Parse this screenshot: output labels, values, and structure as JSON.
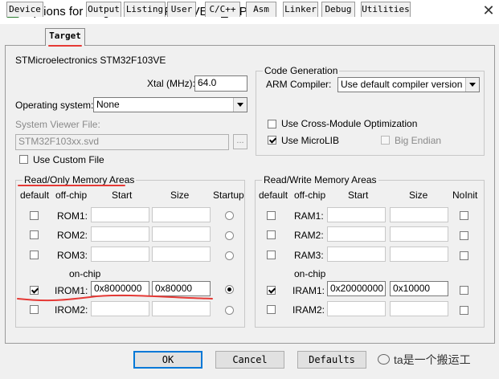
{
  "window": {
    "title": "Options for Target 'STM32F103VETx_IAP'"
  },
  "tabs": [
    {
      "label": "Device"
    },
    {
      "label": "Target"
    },
    {
      "label": "Output"
    },
    {
      "label": "Listing"
    },
    {
      "label": "User"
    },
    {
      "label": "C/C++"
    },
    {
      "label": "Asm"
    },
    {
      "label": "Linker"
    },
    {
      "label": "Debug"
    },
    {
      "label": "Utilities"
    }
  ],
  "active_tab": "Target",
  "device": {
    "name": "STMicroelectronics STM32F103VE"
  },
  "xtal": {
    "label": "Xtal (MHz):",
    "value": "64.0"
  },
  "os": {
    "label": "Operating system:",
    "value": "None"
  },
  "svf": {
    "label": "System Viewer File:",
    "value": "STM32F103xx.svd",
    "browse": "..."
  },
  "custom_file": {
    "label": "Use Custom File",
    "checked": false
  },
  "codegen": {
    "title": "Code Generation",
    "compiler_label": "ARM Compiler:",
    "compiler_value": "Use default compiler version",
    "cross_module": {
      "label": "Use Cross-Module Optimization",
      "checked": false
    },
    "microlib": {
      "label": "Use MicroLIB",
      "checked": true
    },
    "big_endian": {
      "label": "Big Endian",
      "checked": false
    }
  },
  "ro": {
    "title": "Read/Only Memory Areas",
    "headers": {
      "default": "default",
      "offchip": "off-chip",
      "start": "Start",
      "size": "Size",
      "extra": "Startup"
    },
    "onchip_label": "on-chip",
    "rows": [
      {
        "name": "ROM1:",
        "checked": false,
        "start": "",
        "size": "",
        "selected": false
      },
      {
        "name": "ROM2:",
        "checked": false,
        "start": "",
        "size": "",
        "selected": false
      },
      {
        "name": "ROM3:",
        "checked": false,
        "start": "",
        "size": "",
        "selected": false
      },
      {
        "name": "IROM1:",
        "checked": true,
        "start": "0x8000000",
        "size": "0x80000",
        "selected": true
      },
      {
        "name": "IROM2:",
        "checked": false,
        "start": "",
        "size": "",
        "selected": false
      }
    ]
  },
  "rw": {
    "title": "Read/Write Memory Areas",
    "headers": {
      "default": "default",
      "offchip": "off-chip",
      "start": "Start",
      "size": "Size",
      "extra": "NoInit"
    },
    "onchip_label": "on-chip",
    "rows": [
      {
        "name": "RAM1:",
        "checked": false,
        "start": "",
        "size": "",
        "noinit": false
      },
      {
        "name": "RAM2:",
        "checked": false,
        "start": "",
        "size": "",
        "noinit": false
      },
      {
        "name": "RAM3:",
        "checked": false,
        "start": "",
        "size": "",
        "noinit": false
      },
      {
        "name": "IRAM1:",
        "checked": true,
        "start": "0x20000000",
        "size": "0x10000",
        "noinit": false
      },
      {
        "name": "IRAM2:",
        "checked": false,
        "start": "",
        "size": "",
        "noinit": false
      }
    ]
  },
  "buttons": {
    "ok": "OK",
    "cancel": "Cancel",
    "defaults": "Defaults"
  },
  "watermark": {
    "text": "ta是一个搬运工"
  },
  "colors": {
    "annotation": "#e53935",
    "focus": "#0078d7",
    "dialog_bg": "#f0f0f0"
  }
}
